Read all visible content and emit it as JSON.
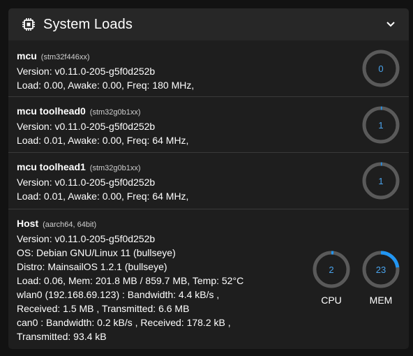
{
  "header": {
    "title": "System Loads",
    "icon": "chip-icon"
  },
  "colors": {
    "accent": "#2196f3",
    "track": "#5a5a5a"
  },
  "mcus": [
    {
      "name": "mcu",
      "chip": "(stm32f446xx)",
      "version": "Version: v0.11.0-205-g5f0d252b",
      "load": "Load: 0.00, Awake: 0.00, Freq: 180 MHz,",
      "gauge_value": "0",
      "gauge_percent": 0
    },
    {
      "name": "mcu toolhead0",
      "chip": "(stm32g0b1xx)",
      "version": "Version: v0.11.0-205-g5f0d252b",
      "load": "Load: 0.01, Awake: 0.00, Freq: 64 MHz,",
      "gauge_value": "1",
      "gauge_percent": 1
    },
    {
      "name": "mcu toolhead1",
      "chip": "(stm32g0b1xx)",
      "version": "Version: v0.11.0-205-g5f0d252b",
      "load": "Load: 0.01, Awake: 0.00, Freq: 64 MHz,",
      "gauge_value": "1",
      "gauge_percent": 1
    }
  ],
  "host": {
    "name": "Host",
    "arch": "(aarch64, 64bit)",
    "lines": [
      "Version: v0.11.0-205-g5f0d252b",
      "OS: Debian GNU/Linux 11 (bullseye)",
      "Distro: MainsailOS 1.2.1 (bullseye)",
      "Load: 0.06, Mem: 201.8 MB / 859.7 MB, Temp: 52°C",
      "wlan0 (192.168.69.123) : Bandwidth: 4.4 kB/s ,",
      "Received: 1.5 MB , Transmitted: 6.6 MB",
      "can0 : Bandwidth: 0.2 kB/s , Received: 178.2 kB ,",
      "Transmitted: 93.4 kB"
    ],
    "cpu": {
      "value": "2",
      "percent": 2,
      "label": "CPU"
    },
    "mem": {
      "value": "23",
      "percent": 23,
      "label": "MEM"
    }
  }
}
